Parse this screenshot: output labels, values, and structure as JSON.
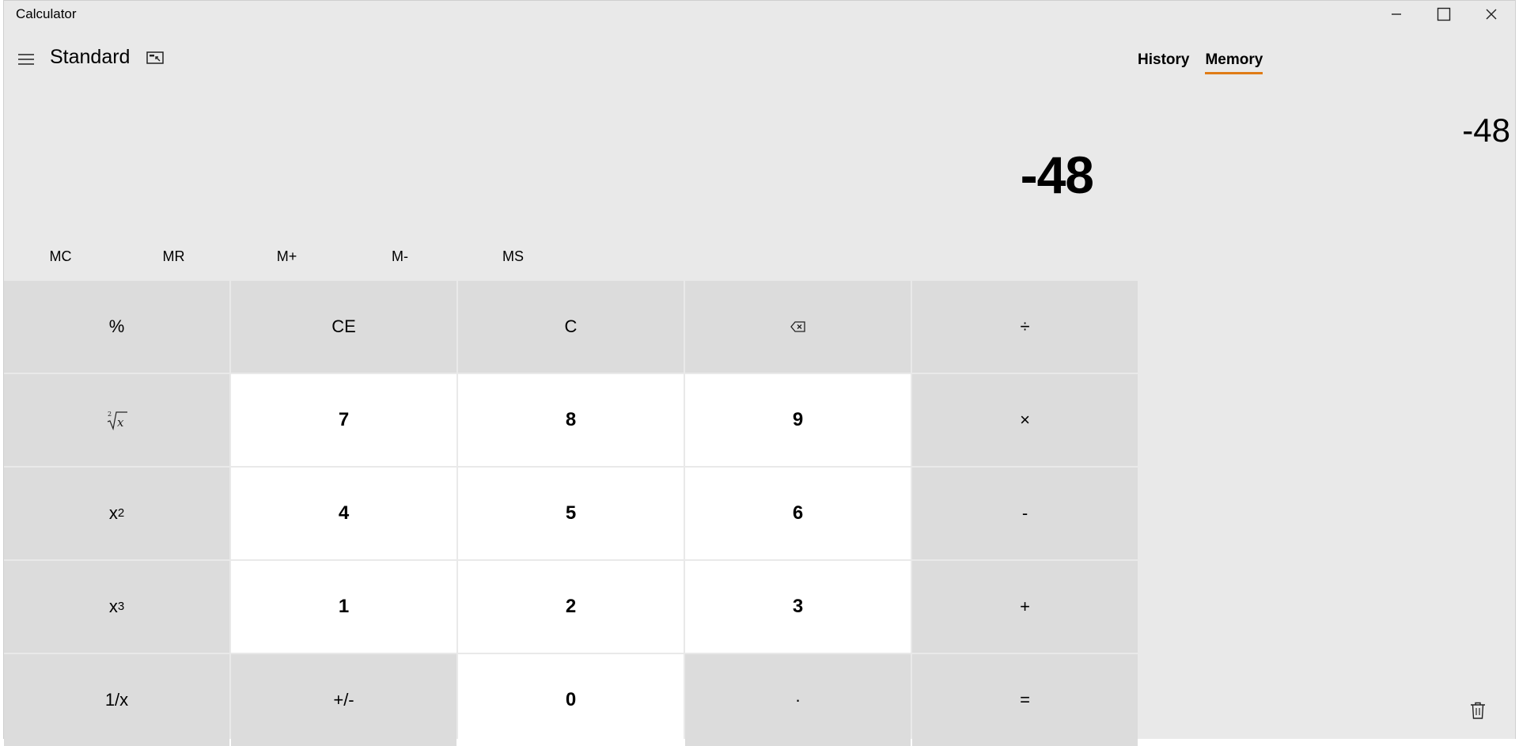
{
  "window": {
    "title": "Calculator"
  },
  "header": {
    "mode": "Standard"
  },
  "display": {
    "value": "-48"
  },
  "memory_buttons": [
    "MC",
    "MR",
    "M+",
    "M-",
    "MS"
  ],
  "keys": {
    "percent": "%",
    "ce": "CE",
    "c": "C",
    "divide": "÷",
    "seven": "7",
    "eight": "8",
    "nine": "9",
    "multiply": "×",
    "four": "4",
    "five": "5",
    "six": "6",
    "minus": "-",
    "one": "1",
    "two": "2",
    "three": "3",
    "plus": "+",
    "reciprocal": "1/x",
    "negate": "+/-",
    "zero": "0",
    "decimal": "·",
    "equals": "=",
    "x_base": "x",
    "square_exp": "2",
    "cube_exp": "3"
  },
  "panel": {
    "tabs": [
      "History",
      "Memory"
    ],
    "active_tab": "Memory",
    "memory_items": [
      "-48"
    ]
  },
  "colors": {
    "window_bg": "#e9e9e9",
    "operator_key_bg": "#dcdcdc",
    "number_key_bg": "#ffffff",
    "accent": "#e07b16"
  },
  "icons": {
    "menu": "hamburger-icon",
    "keep_on_top": "keep-on-top-icon",
    "backspace": "backspace-icon",
    "square_root": "square-root-icon",
    "trash": "trash-icon",
    "minimize": "minimize-icon",
    "maximize": "maximize-icon",
    "close": "close-icon"
  }
}
